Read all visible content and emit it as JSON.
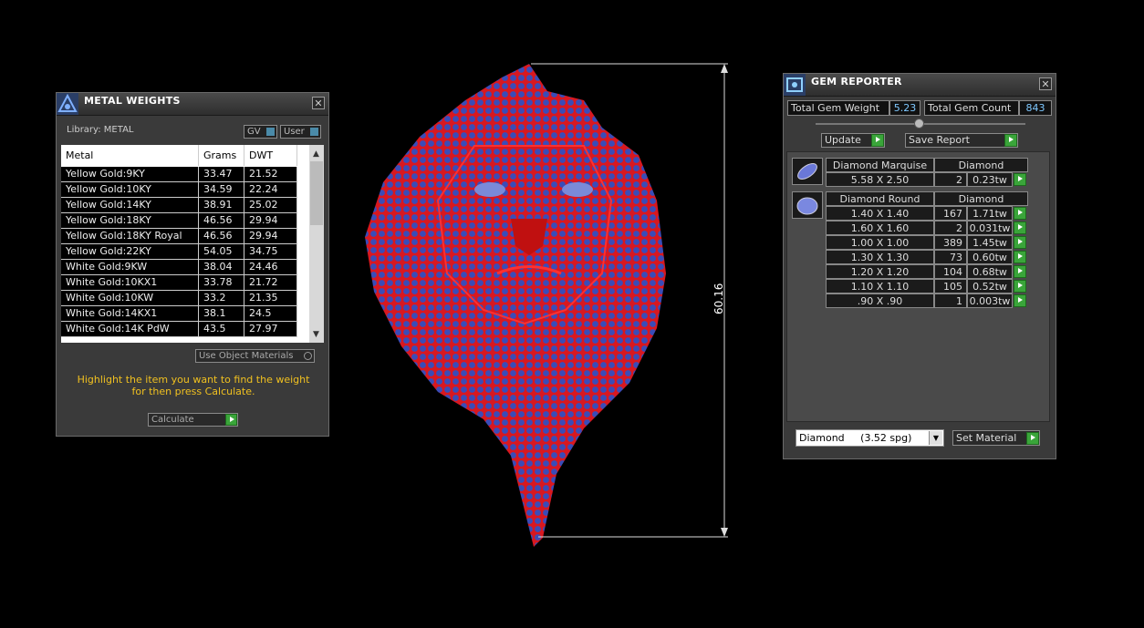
{
  "metal_weights": {
    "title": "METAL WEIGHTS",
    "library": "Library: METAL",
    "toggles": [
      "GV",
      "User"
    ],
    "columns": [
      "Metal",
      "Grams",
      "DWT"
    ],
    "rows": [
      [
        "Yellow Gold:9KY",
        "33.47",
        "21.52"
      ],
      [
        "Yellow Gold:10KY",
        "34.59",
        "22.24"
      ],
      [
        "Yellow Gold:14KY",
        "38.91",
        "25.02"
      ],
      [
        "Yellow Gold:18KY",
        "46.56",
        "29.94"
      ],
      [
        "Yellow Gold:18KY Royal",
        "46.56",
        "29.94"
      ],
      [
        "Yellow Gold:22KY",
        "54.05",
        "34.75"
      ],
      [
        "White Gold:9KW",
        "38.04",
        "24.46"
      ],
      [
        "White Gold:10KX1",
        "33.78",
        "21.72"
      ],
      [
        "White Gold:10KW",
        "33.2",
        "21.35"
      ],
      [
        "White Gold:14KX1",
        "38.1",
        "24.5"
      ],
      [
        "White Gold:14K PdW",
        "43.5",
        "27.97"
      ]
    ],
    "use_object_materials": "Use Object Materials",
    "instruction": "Highlight the item you want to find the weight for then press Calculate.",
    "calculate_label": "Calculate"
  },
  "viewport": {
    "dimension_label": "60.16"
  },
  "gem_reporter": {
    "title": "GEM REPORTER",
    "total_weight_label": "Total Gem Weight",
    "total_weight_value": "5.23",
    "total_count_label": "Total Gem Count",
    "total_count_value": "843",
    "update_label": "Update",
    "save_report_label": "Save Report",
    "groups": [
      {
        "shape": "Diamond Marquise",
        "material": "Diamond",
        "icon": "marquise-gem-icon",
        "rows": [
          [
            "5.58 X 2.50",
            "2",
            "0.23tw"
          ]
        ]
      },
      {
        "shape": "Diamond Round",
        "material": "Diamond",
        "icon": "round-gem-icon",
        "rows": [
          [
            "1.40 X 1.40",
            "167",
            "1.71tw"
          ],
          [
            "1.60 X 1.60",
            "2",
            "0.031tw"
          ],
          [
            "1.00 X 1.00",
            "389",
            "1.45tw"
          ],
          [
            "1.30 X 1.30",
            "73",
            "0.60tw"
          ],
          [
            "1.20 X 1.20",
            "104",
            "0.68tw"
          ],
          [
            "1.10 X 1.10",
            "105",
            "0.52tw"
          ],
          [
            ".90 X .90",
            "1",
            "0.003tw"
          ]
        ]
      }
    ],
    "material_select": "Diamond     (3.52 spg)",
    "set_material_label": "Set Material"
  },
  "colors": {
    "accent_yellow": "#f0c020",
    "green_button": "#3aa53a",
    "gem_blue": "#3a4cb8",
    "gem_red": "#d81820"
  }
}
